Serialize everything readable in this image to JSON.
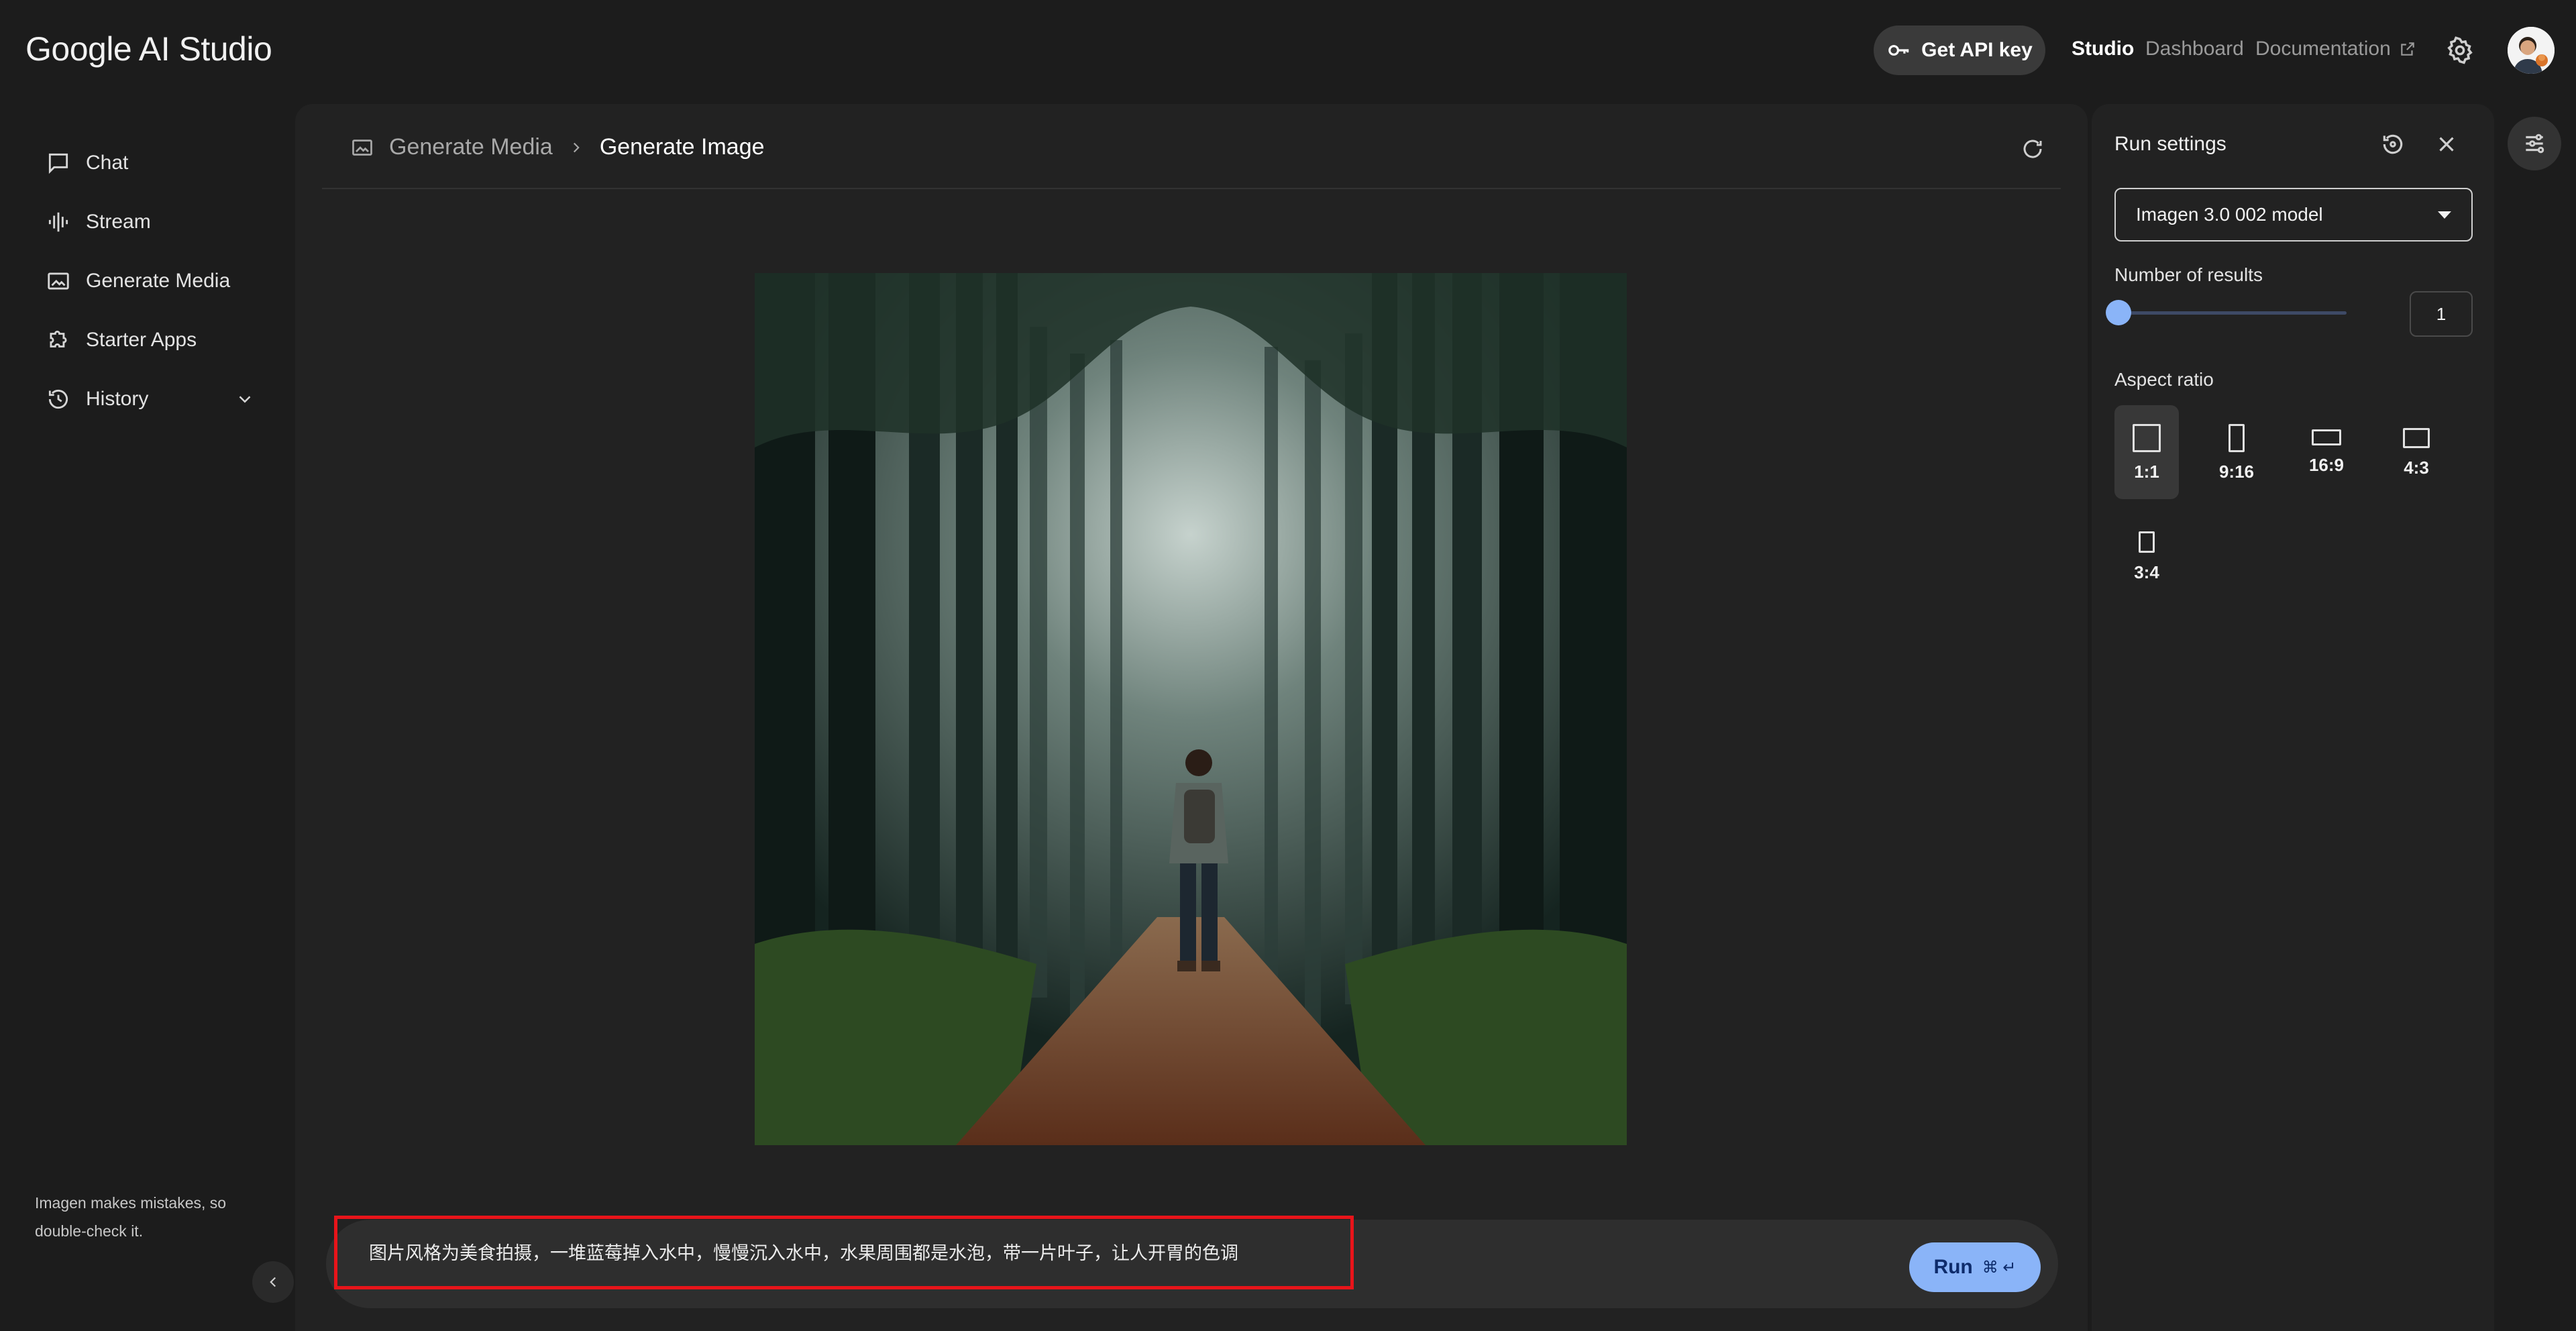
{
  "app": {
    "logo_text": "Google AI Studio"
  },
  "topbar": {
    "api_key_label": "Get API key",
    "nav": {
      "studio": "Studio",
      "dashboard": "Dashboard",
      "documentation": "Documentation"
    }
  },
  "sidebar": {
    "items": [
      {
        "label": "Chat",
        "icon": "chat-icon"
      },
      {
        "label": "Stream",
        "icon": "stream-icon"
      },
      {
        "label": "Generate Media",
        "icon": "image-icon"
      },
      {
        "label": "Starter Apps",
        "icon": "puzzle-icon"
      },
      {
        "label": "History",
        "icon": "history-icon"
      }
    ],
    "disclaimer": "Imagen makes mistakes, so double-check it."
  },
  "breadcrumb": {
    "parent": "Generate Media",
    "current": "Generate Image"
  },
  "prompt": {
    "text": "图片风格为美食拍摄，一堆蓝莓掉入水中，慢慢沉入水中，水果周围都是水泡，带一片叶子，让人开胃的色调",
    "run_label": "Run",
    "shortcut": "⌘ ↵"
  },
  "run_settings": {
    "title": "Run settings",
    "model": "Imagen 3.0 002 model",
    "num_results_label": "Number of results",
    "num_results": "1",
    "num_results_fraction": 0.0,
    "aspect_ratio_label": "Aspect ratio",
    "aspect_ratios": [
      "1:1",
      "9:16",
      "16:9",
      "4:3",
      "3:4"
    ],
    "selected_aspect_ratio": "1:1"
  },
  "colors": {
    "accent": "#8ab4f8",
    "highlight_border": "#e8141a",
    "background": "#1c1c1c"
  }
}
